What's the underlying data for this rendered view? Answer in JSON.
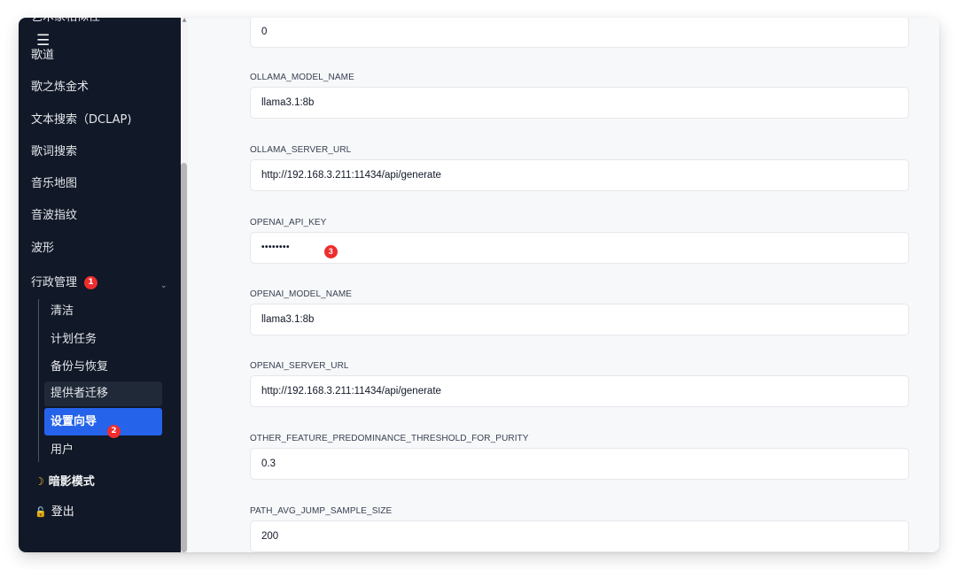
{
  "sidebar": {
    "top_cut_item": "艺术家相似性",
    "items": [
      {
        "label": "歌道"
      },
      {
        "label": "歌之炼金术"
      },
      {
        "label": "文本搜索（DCLAP)"
      },
      {
        "label": "歌词搜索"
      },
      {
        "label": "音乐地图"
      },
      {
        "label": "音波指纹"
      },
      {
        "label": "波形"
      },
      {
        "label": "行政管理",
        "badge": "1"
      }
    ],
    "admin_sub_items": [
      {
        "label": "清洁"
      },
      {
        "label": "计划任务"
      },
      {
        "label": "备份与恢复"
      },
      {
        "label": "提供者迁移"
      },
      {
        "label": "设置向导",
        "badge": "2"
      },
      {
        "label": "用户"
      }
    ],
    "dark_mode": {
      "label": "暗影模式",
      "icon": "moon-icon"
    },
    "logout": {
      "label": "登出",
      "icon": "unlock-icon"
    },
    "hamburger_icon": "☰",
    "chevron_icon": "⌄"
  },
  "settings": {
    "first_value": "0",
    "fields": [
      {
        "label": "OLLAMA_MODEL_NAME",
        "value": "llama3.1:8b"
      },
      {
        "label": "OLLAMA_SERVER_URL",
        "value": "http://192.168.3.211:11434/api/generate"
      },
      {
        "label": "OPENAI_API_KEY",
        "value": "••••••••",
        "badge": "3"
      },
      {
        "label": "OPENAI_MODEL_NAME",
        "value": "llama3.1:8b"
      },
      {
        "label": "OPENAI_SERVER_URL",
        "value": "http://192.168.3.211:11434/api/generate"
      },
      {
        "label": "OTHER_FEATURE_PREDOMINANCE_THRESHOLD_FOR_PURITY",
        "value": "0.3"
      },
      {
        "label": "PATH_AVG_JUMP_SAMPLE_SIZE",
        "value": "200"
      }
    ]
  },
  "colors": {
    "sidebar_bg": "#111827",
    "active_item": "#2563eb",
    "badge": "#ef2d2d"
  }
}
